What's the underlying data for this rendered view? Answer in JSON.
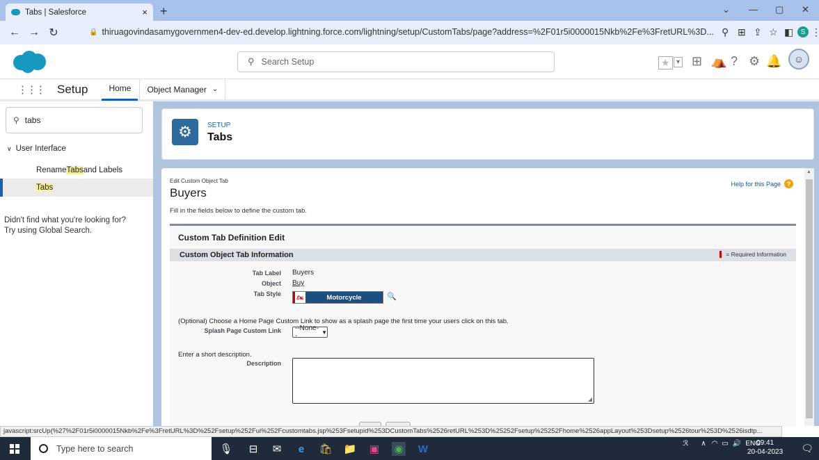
{
  "browser": {
    "tab_title": "Tabs | Salesforce",
    "tab_close": "×",
    "new_tab": "+",
    "url": "thiruagovindasamygovernmen4-dev-ed.develop.lightning.force.com/lightning/setup/CustomTabs/page?address=%2F01r5i0000015Nkb%2Fe%3FretURL%3D...",
    "status_url": "javascript:srcUp(%27%2F01r5i0000015Nkb%2Fe%3FretURL%3D%252Fsetup%252Fui%252Fcustomtabs.jsp%253Fsetupid%253DCustomTabs%2526retURL%253D%25252Fsetup%25252Fhome%2526appLayout%253Dsetup%2526tour%253D%2526isdtp..."
  },
  "header": {
    "search_placeholder": "Search Setup",
    "notification_count": "8"
  },
  "nav": {
    "app_name": "Setup",
    "home_tab": "Home",
    "object_manager_tab": "Object Manager"
  },
  "sidebar": {
    "quick_find_value": "tabs",
    "section": "User Interface",
    "item1_pre": "Rename ",
    "item1_hl": "Tabs",
    "item1_post": " and Labels",
    "item2": "Tabs",
    "not_found_line1": "Didn't find what you're looking for?",
    "not_found_line2": "Try using Global Search."
  },
  "setup_card": {
    "small": "SETUP",
    "title": "Tabs"
  },
  "form": {
    "edit_label": "Edit Custom Object Tab",
    "title": "Buyers",
    "help": "Help for this Page",
    "instructions": "Fill in the fields below to define the custom tab.",
    "section_title": "Custom Tab Definition Edit",
    "info_title": "Custom Object Tab Information",
    "required_info": "= Required Information",
    "tab_label_label": "Tab Label",
    "tab_label_value": "Buyers",
    "object_label": "Object",
    "object_value": "Buy",
    "tab_style_label": "Tab Style",
    "tab_style_value": "Motorcycle",
    "optional_text": "(Optional) Choose a Home Page Custom Link to show as a splash page the first time your users click on this tab.",
    "splash_label": "Splash Page Custom Link",
    "splash_value": "--None--",
    "short_desc": "Enter a short description.",
    "description_label": "Description"
  },
  "taskbar": {
    "search_placeholder": "Type here to search",
    "language": "ENG",
    "time": "09:41",
    "date": "20-04-2023"
  },
  "colors": {
    "tabbar": "#a8c1ea",
    "brand_blue": "#1798c1",
    "setup_blue": "#2f6a9e",
    "taskbar": "#1f2b3a"
  }
}
